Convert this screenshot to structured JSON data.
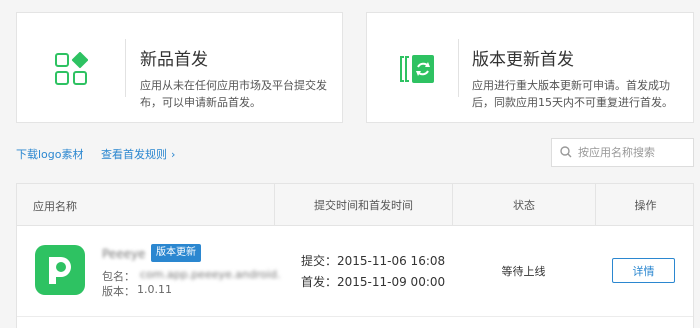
{
  "cards": {
    "new": {
      "title": "新品首发",
      "desc": "应用从未在任何应用市场及平台提交发布，可以申请新品首发。"
    },
    "update": {
      "title": "版本更新首发",
      "desc": "应用进行重大版本更新可申请。首发成功后，同款应用15天内不可重复进行首发。"
    }
  },
  "links": {
    "download_logo": "下载logo素材",
    "view_rules": "查看首发规则"
  },
  "search": {
    "placeholder": "按应用名称搜索"
  },
  "table": {
    "headers": {
      "name": "应用名称",
      "time": "提交时间和首发时间",
      "status": "状态",
      "action": "操作"
    },
    "rows": [
      {
        "app_name": "Peeeye",
        "badge": "版本更新",
        "package_label": "包名：",
        "package_value": "com.app.peeeye.android.",
        "version_label": "版本：",
        "version_value": "1.0.11",
        "submit_time": "提交：2015-11-06 16:08",
        "launch_time": "首发：2015-11-09 00:00",
        "status": "等待上线",
        "action": "详情"
      }
    ]
  },
  "colors": {
    "accent_green": "#2ec262",
    "link_blue": "#2b87d0"
  }
}
